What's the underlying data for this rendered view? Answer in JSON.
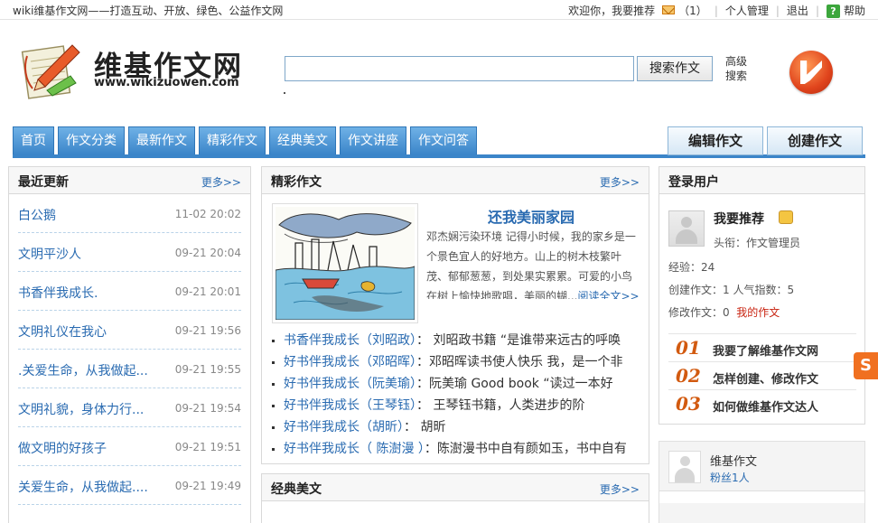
{
  "topbar": {
    "slogan": "wiki维基作文网——打造互动、开放、绿色、公益作文网",
    "welcome": "欢迎你，我要推荐",
    "mail_count": "（1）",
    "profile": "个人管理",
    "logout": "退出",
    "help": "帮助",
    "separator": "|"
  },
  "header": {
    "logo_name": "维基作文网",
    "logo_url": "www.wikizuowen.com",
    "search_placeholder": "",
    "search_button": "搜索作文",
    "advanced_search": "高级搜索"
  },
  "nav": {
    "tabs": [
      "首页",
      "作文分类",
      "最新作文",
      "精彩作文",
      "经典美文",
      "作文讲座",
      "作文问答"
    ],
    "edit_button": "编辑作文",
    "create_button": "创建作文"
  },
  "recent": {
    "title": "最近更新",
    "more": "更多>>",
    "items": [
      {
        "title": "白公鹅",
        "date": "11-02 20:02"
      },
      {
        "title": "文明平沙人",
        "date": "09-21 20:04"
      },
      {
        "title": "书香伴我成长.",
        "date": "09-21 20:01"
      },
      {
        "title": "文明礼仪在我心",
        "date": "09-21 19:56"
      },
      {
        "title": ".关爱生命，从我做起...",
        "date": "09-21 19:55"
      },
      {
        "title": "文明礼貌，身体力行...",
        "date": "09-21 19:54"
      },
      {
        "title": "做文明的好孩子",
        "date": "09-21 19:51"
      },
      {
        "title": "关爱生命，从我做起....",
        "date": "09-21 19:49"
      }
    ]
  },
  "featured": {
    "title": "精彩作文",
    "more": "更多>>",
    "article_title": "还我美丽家园",
    "excerpt": "邓杰娴污染环境  记得小时候，我的家乡是一个景色宜人的好地方。山上的树木枝繁叶茂、郁郁葱葱，到处果实累累。可爱的小鸟在树上愉快地歌唱，美丽的蝴...",
    "read_more": "阅读全文>>",
    "list": [
      {
        "title": "书香伴我成长（刘昭政）",
        "text": "：   刘昭政书籍 “是谁带来远古的呼唤"
      },
      {
        "title": "好书伴我成长（邓昭晖）",
        "text": "：邓昭晖读书使人快乐 我，是一个非"
      },
      {
        "title": "好书伴我成长（阮美瑜）",
        "text": "：阮美瑜  Good book “读过一本好"
      },
      {
        "title": "好书伴我成长（王琴钰）",
        "text": "：          王琴钰书籍，人类进步的阶"
      },
      {
        "title": "好书伴我成长（胡昕）",
        "text": "：              胡昕"
      },
      {
        "title": "好书伴我成长（ 陈澍漫 ）",
        "text": "：陈澍漫书中自有颜如玉，书中自有"
      }
    ]
  },
  "classic": {
    "title": "经典美文",
    "more": "更多>>"
  },
  "login": {
    "title": "登录用户",
    "username": "我要推荐",
    "rank": "头衔：作文管理员",
    "exp": "经验：24",
    "created": "创建作文：1  人气指数：5",
    "edited": "修改作文：0",
    "my_articles": "我的作文",
    "guides": [
      {
        "num": "01",
        "text": "我要了解维基作文网"
      },
      {
        "num": "02",
        "text": "怎样创建、修改作文"
      },
      {
        "num": "03",
        "text": "如何做维基作文达人"
      }
    ]
  },
  "follow": {
    "name": "维基作文",
    "fans": "粉丝1人"
  },
  "float_label": "S"
}
